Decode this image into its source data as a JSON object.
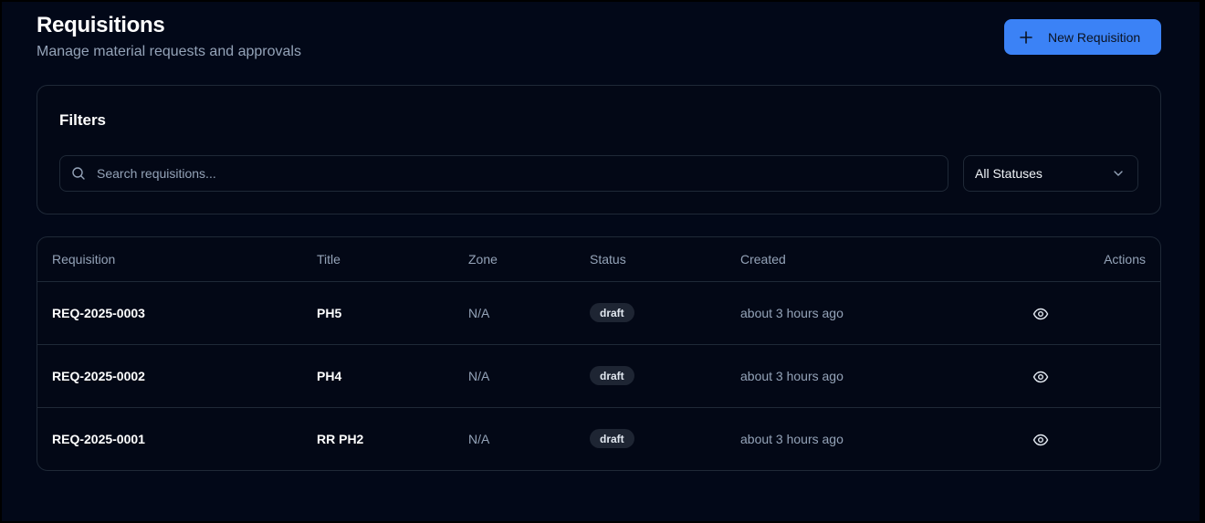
{
  "header": {
    "title": "Requisitions",
    "subtitle": "Manage material requests and approvals",
    "new_button_label": "New Requisition"
  },
  "filters": {
    "title": "Filters",
    "search_placeholder": "Search requisitions...",
    "status_selected": "All Statuses"
  },
  "table": {
    "columns": {
      "requisition": "Requisition",
      "title": "Title",
      "zone": "Zone",
      "status": "Status",
      "created": "Created",
      "actions": "Actions"
    },
    "rows": [
      {
        "id": "REQ-2025-0003",
        "title": "PH5",
        "zone": "N/A",
        "status": "draft",
        "created": "about 3 hours ago"
      },
      {
        "id": "REQ-2025-0002",
        "title": "PH4",
        "zone": "N/A",
        "status": "draft",
        "created": "about 3 hours ago"
      },
      {
        "id": "REQ-2025-0001",
        "title": "RR PH2",
        "zone": "N/A",
        "status": "draft",
        "created": "about 3 hours ago"
      }
    ]
  },
  "icons": {
    "new_button": "plus-icon",
    "search": "search-icon",
    "select": "chevron-down-icon",
    "row_action": "eye-icon"
  },
  "colors": {
    "accent": "#3b82f6",
    "background": "#020818",
    "badge_bg": "#1e2533"
  }
}
